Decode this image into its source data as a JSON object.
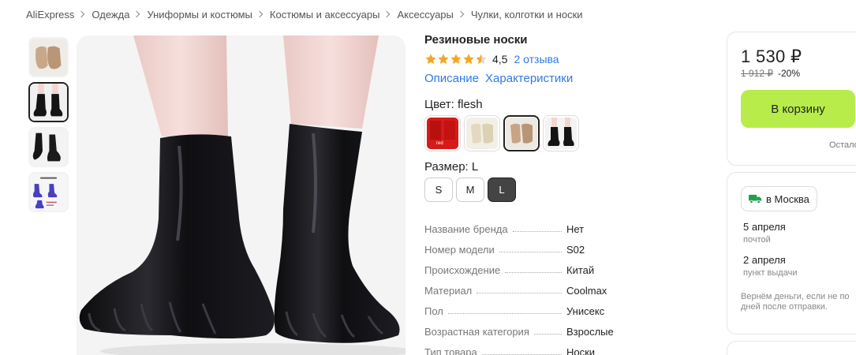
{
  "breadcrumb": [
    "AliExpress",
    "Одежда",
    "Униформы и костюмы",
    "Костюмы и аксессуары",
    "Аксессуары",
    "Чулки, колготки и носки"
  ],
  "product": {
    "title": "Резиновые носки",
    "rating": "4,5",
    "rating_value": 4.5,
    "reviews": "2 отзыва",
    "tabs": [
      "Описание",
      "Характеристики"
    ]
  },
  "color": {
    "label": "Цвет:",
    "selected": "flesh",
    "options": [
      {
        "name": "red",
        "text": "red",
        "active": false
      },
      {
        "name": "beige-light",
        "active": false
      },
      {
        "name": "flesh",
        "active": true
      },
      {
        "name": "black",
        "active": false
      }
    ]
  },
  "size": {
    "label": "Размер:",
    "selected": "L",
    "options": [
      "S",
      "M",
      "L"
    ]
  },
  "specs": [
    {
      "name": "Название бренда",
      "value": "Нет"
    },
    {
      "name": "Номер модели",
      "value": "S02"
    },
    {
      "name": "Происхождение",
      "value": "Китай"
    },
    {
      "name": "Материал",
      "value": "Coolmax"
    },
    {
      "name": "Пол",
      "value": "Унисекс"
    },
    {
      "name": "Возрастная категория",
      "value": "Взрослые"
    },
    {
      "name": "Тип товара",
      "value": "Носки"
    }
  ],
  "buy": {
    "price": "1 530 ₽",
    "old_price": "1 912 ₽",
    "discount": "-20%",
    "cart_label": "В корзину",
    "stock": "Осталось"
  },
  "delivery": {
    "city": "в Москва",
    "options": [
      {
        "date": "5 апреля",
        "type": "почтой"
      },
      {
        "date": "2 апреля",
        "type": "пункт выдачи"
      }
    ],
    "refund_line1": "Вернём деньги, если не по",
    "refund_line2": "дней после отправки."
  },
  "colors": {
    "link": "#2f7ae5",
    "star": "#f5a623",
    "cart": "#b7ec4b"
  },
  "thumbs": [
    "flesh-socks-photo",
    "black-socks-photo",
    "black-socks-side-photo",
    "size-chart-photo"
  ]
}
